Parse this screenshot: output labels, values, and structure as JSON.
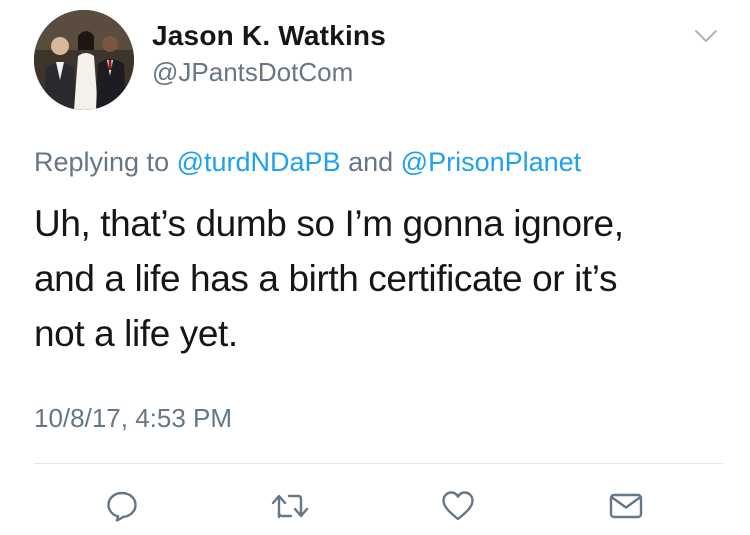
{
  "user": {
    "display_name": "Jason K. Watkins",
    "handle": "@JPantsDotCom"
  },
  "reply": {
    "prefix": "Replying to",
    "mention_1": "@turdNDaPB",
    "conjunction": "and",
    "mention_2": "@PrisonPlanet"
  },
  "tweet": {
    "line_1": "Uh, that’s dumb so I’m gonna ignore,",
    "line_2": "and a life has a birth certificate or it’s",
    "line_3": "not a life yet.",
    "timestamp": "10/8/17, 4:53 PM"
  },
  "actions": [
    "reply-icon",
    "retweet-icon",
    "like-icon",
    "message-icon"
  ],
  "colors": {
    "text": "#14171a",
    "secondary": "#657786",
    "link": "#1da1f2",
    "divider": "#e1e8ed"
  }
}
